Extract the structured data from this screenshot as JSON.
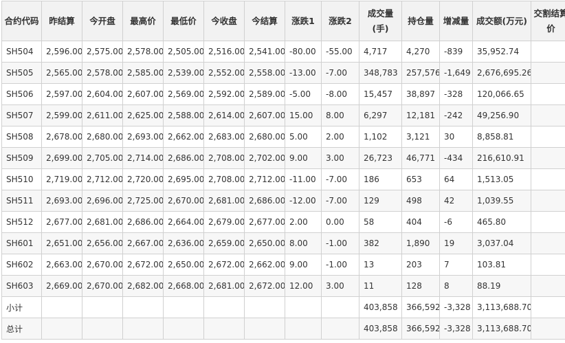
{
  "table": {
    "headers": [
      "合约代码",
      "昨结算",
      "今开盘",
      "最高价",
      "最低价",
      "今收盘",
      "今结算",
      "涨跌1",
      "涨跌2",
      "成交量(手)",
      "持仓量",
      "增减量",
      "成交额(万元)",
      "交割结算价"
    ],
    "rows": [
      [
        "SH504",
        "2,596.00",
        "2,575.00",
        "2,578.00",
        "2,505.00",
        "2,516.00",
        "2,541.00",
        "-80.00",
        "-55.00",
        "4,717",
        "4,270",
        "-839",
        "35,952.74",
        ""
      ],
      [
        "SH505",
        "2,565.00",
        "2,578.00",
        "2,585.00",
        "2,539.00",
        "2,552.00",
        "2,558.00",
        "-13.00",
        "-7.00",
        "348,783",
        "257,576",
        "-1,649",
        "2,676,695.26",
        ""
      ],
      [
        "SH506",
        "2,597.00",
        "2,604.00",
        "2,607.00",
        "2,569.00",
        "2,592.00",
        "2,589.00",
        "-5.00",
        "-8.00",
        "15,457",
        "38,897",
        "-328",
        "120,066.65",
        ""
      ],
      [
        "SH507",
        "2,599.00",
        "2,611.00",
        "2,625.00",
        "2,588.00",
        "2,614.00",
        "2,607.00",
        "15.00",
        "8.00",
        "6,297",
        "12,181",
        "-242",
        "49,256.90",
        ""
      ],
      [
        "SH508",
        "2,678.00",
        "2,680.00",
        "2,693.00",
        "2,662.00",
        "2,683.00",
        "2,680.00",
        "5.00",
        "2.00",
        "1,102",
        "3,121",
        "30",
        "8,858.81",
        ""
      ],
      [
        "SH509",
        "2,699.00",
        "2,705.00",
        "2,714.00",
        "2,686.00",
        "2,708.00",
        "2,702.00",
        "9.00",
        "3.00",
        "26,723",
        "46,771",
        "-434",
        "216,610.91",
        ""
      ],
      [
        "SH510",
        "2,719.00",
        "2,712.00",
        "2,720.00",
        "2,695.00",
        "2,708.00",
        "2,712.00",
        "-11.00",
        "-7.00",
        "186",
        "653",
        "64",
        "1,513.05",
        ""
      ],
      [
        "SH511",
        "2,693.00",
        "2,696.00",
        "2,725.00",
        "2,670.00",
        "2,681.00",
        "2,686.00",
        "-12.00",
        "-7.00",
        "129",
        "498",
        "42",
        "1,039.55",
        ""
      ],
      [
        "SH512",
        "2,677.00",
        "2,681.00",
        "2,686.00",
        "2,664.00",
        "2,679.00",
        "2,677.00",
        "2.00",
        "0.00",
        "58",
        "404",
        "-6",
        "465.80",
        ""
      ],
      [
        "SH601",
        "2,651.00",
        "2,656.00",
        "2,667.00",
        "2,636.00",
        "2,659.00",
        "2,650.00",
        "8.00",
        "-1.00",
        "382",
        "1,890",
        "19",
        "3,037.04",
        ""
      ],
      [
        "SH602",
        "2,663.00",
        "2,670.00",
        "2,672.00",
        "2,650.00",
        "2,672.00",
        "2,662.00",
        "9.00",
        "-1.00",
        "13",
        "203",
        "7",
        "103.81",
        ""
      ],
      [
        "SH603",
        "2,669.00",
        "2,670.00",
        "2,682.00",
        "2,668.00",
        "2,681.00",
        "2,672.00",
        "12.00",
        "3.00",
        "11",
        "128",
        "8",
        "88.19",
        ""
      ]
    ],
    "subtotal": [
      "小计",
      "",
      "",
      "",
      "",
      "",
      "",
      "",
      "",
      "403,858",
      "366,592",
      "-3,328",
      "3,113,688.70",
      ""
    ],
    "total": [
      "总计",
      "",
      "",
      "",
      "",
      "",
      "",
      "",
      "",
      "403,858",
      "366,592",
      "-3,328",
      "3,113,688.70",
      ""
    ]
  }
}
